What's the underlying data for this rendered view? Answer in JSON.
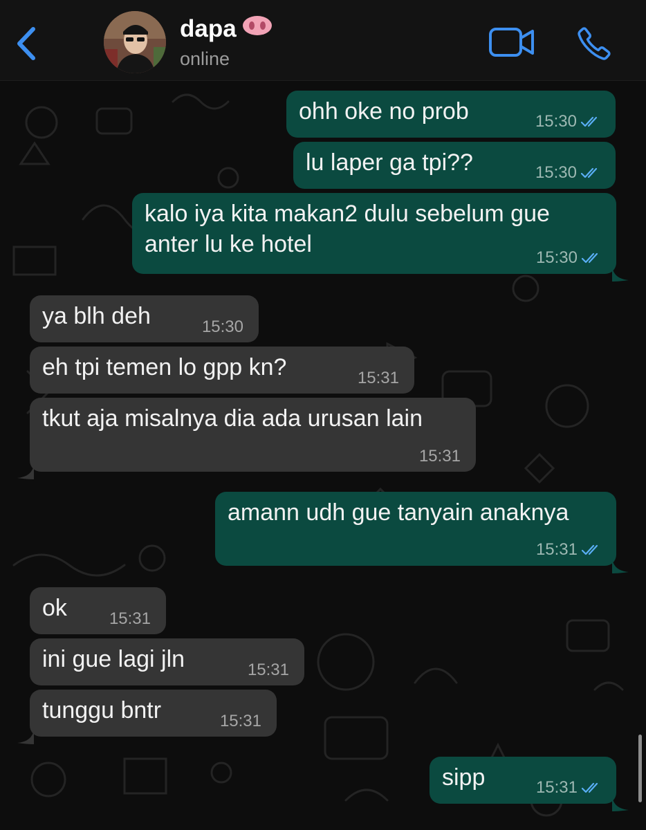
{
  "header": {
    "contact_name": "dapa",
    "status": "online",
    "name_emoji_icon": "pig-nose-icon"
  },
  "messages": [
    {
      "dir": "out",
      "lines": [
        "ohh oke no prob"
      ],
      "time": "15:30",
      "read": true
    },
    {
      "dir": "out",
      "lines": [
        "lu laper ga tpi??"
      ],
      "time": "15:30",
      "read": true
    },
    {
      "dir": "out",
      "lines": [
        "kalo iya kita makan2 dulu sebelum gue",
        "anter lu ke hotel"
      ],
      "time": "15:30",
      "read": true
    },
    {
      "dir": "in",
      "lines": [
        "ya blh deh"
      ],
      "time": "15:30"
    },
    {
      "dir": "in",
      "lines": [
        "eh tpi temen lo gpp kn?"
      ],
      "time": "15:31"
    },
    {
      "dir": "in",
      "lines": [
        "tkut aja misalnya dia ada urusan lain"
      ],
      "time": "15:31"
    },
    {
      "dir": "out",
      "lines": [
        "amann udh gue tanyain anaknya"
      ],
      "time": "15:31",
      "read": true
    },
    {
      "dir": "in",
      "lines": [
        "ok"
      ],
      "time": "15:31"
    },
    {
      "dir": "in",
      "lines": [
        "ini gue lagi jln"
      ],
      "time": "15:31"
    },
    {
      "dir": "in",
      "lines": [
        "tunggu bntr"
      ],
      "time": "15:31"
    },
    {
      "dir": "out",
      "lines": [
        "sipp"
      ],
      "time": "15:31",
      "read": true
    }
  ],
  "colors": {
    "outgoing_bubble": "#0b4a40",
    "incoming_bubble": "#353535",
    "accent_blue": "#3d8ff0",
    "read_ticks": "#5aaef5"
  }
}
